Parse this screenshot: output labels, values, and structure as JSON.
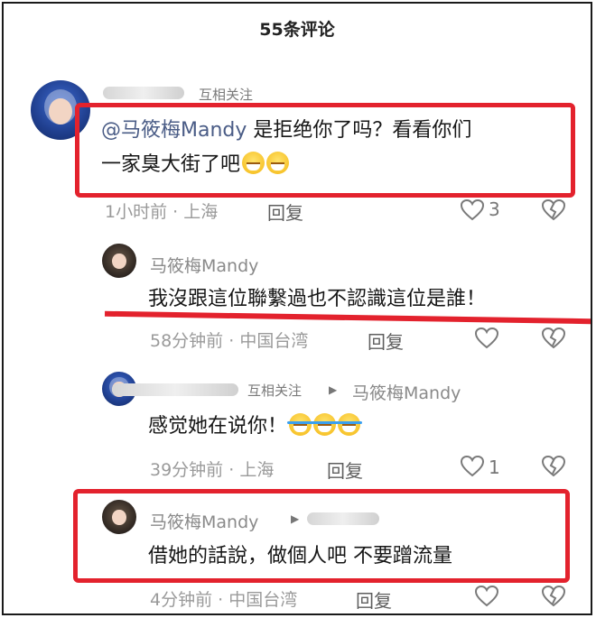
{
  "header": {
    "title": "55条评论"
  },
  "comments": [
    {
      "relation": "互相关注",
      "text_mention": "@马筱梅Mandy",
      "text_body": " 是拒绝你了吗？看看你们",
      "text_line2": "一家臭大街了吧",
      "time": "1小时前",
      "location": "上海",
      "reply_label": "回复",
      "like_count": "3"
    },
    {
      "username": "马筱梅Mandy",
      "text": "我沒跟這位聯繫過也不認識這位是誰！",
      "time": "58分钟前",
      "location": "中国台湾",
      "reply_label": "回复"
    },
    {
      "relation": "互相关注",
      "reply_to": "马筱梅Mandy",
      "text": "感觉她在说你！",
      "time": "39分钟前",
      "location": "上海",
      "reply_label": "回复",
      "like_count": "1"
    },
    {
      "username": "马筱梅Mandy",
      "text": "借她的話說，做個人吧 不要蹭流量",
      "time": "4分钟前",
      "location": "中国台湾",
      "reply_label": "回复"
    }
  ],
  "colors": {
    "highlight_red": "#e3222d",
    "mention_blue": "#4a5c86"
  },
  "icons": {
    "like": "heart-outline-icon",
    "dislike": "broken-heart-icon",
    "reply_arrow": "triangle-right-icon"
  }
}
